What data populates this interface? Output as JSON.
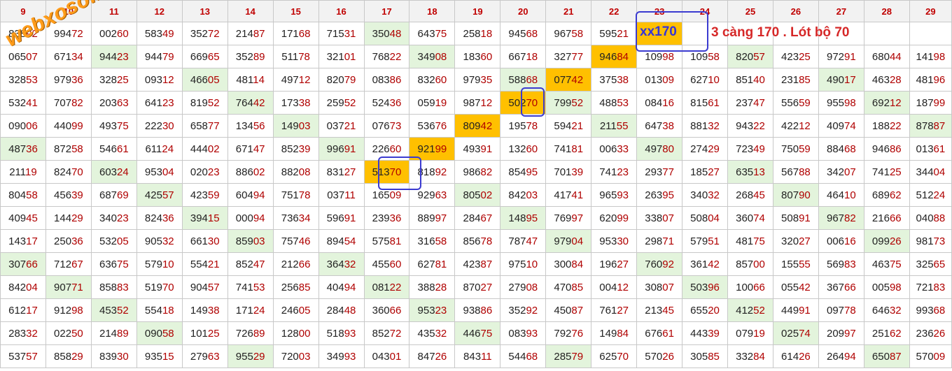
{
  "watermark": "webxoso.net",
  "annotation": {
    "xx": "xx170",
    "note": "3 càng 170 . Lót bộ 70"
  },
  "headers": [
    "9",
    "10",
    "11",
    "12",
    "13",
    "14",
    "15",
    "16",
    "17",
    "18",
    "19",
    "20",
    "21",
    "22",
    "23",
    "24",
    "25",
    "26",
    "27",
    "28",
    "29"
  ],
  "rows": [
    [
      "83892",
      "99472",
      "00260",
      "58349",
      "35272",
      "21487",
      "17168",
      "71531",
      "35048",
      "64375",
      "25818",
      "94568",
      "96758",
      "59521",
      "xx170",
      "",
      "",
      "",
      "",
      "",
      ""
    ],
    [
      "06507",
      "67134",
      "94423",
      "94479",
      "66965",
      "35289",
      "51178",
      "32101",
      "76822",
      "34908",
      "18360",
      "66718",
      "32777",
      "94684",
      "10998",
      "10958",
      "82057",
      "42325",
      "97291",
      "68044",
      "14198"
    ],
    [
      "32853",
      "97936",
      "32825",
      "09312",
      "46605",
      "48114",
      "49712",
      "82079",
      "08386",
      "83260",
      "97935",
      "58868",
      "07742",
      "37538",
      "01309",
      "62710",
      "85140",
      "23185",
      "49017",
      "46328",
      "48196"
    ],
    [
      "53241",
      "70782",
      "20363",
      "64123",
      "81952",
      "76442",
      "17338",
      "25952",
      "52436",
      "05919",
      "98712",
      "50270",
      "79952",
      "48853",
      "08416",
      "81561",
      "23747",
      "55659",
      "95598",
      "69212",
      "18799"
    ],
    [
      "09006",
      "44099",
      "49375",
      "22230",
      "65877",
      "13456",
      "14903",
      "03721",
      "07673",
      "53676",
      "80942",
      "19578",
      "59421",
      "21155",
      "64738",
      "88132",
      "94322",
      "42212",
      "40974",
      "18822",
      "87887"
    ],
    [
      "48736",
      "87258",
      "54661",
      "61124",
      "44402",
      "67147",
      "85239",
      "99691",
      "22660",
      "92199",
      "49391",
      "13260",
      "74181",
      "00633",
      "49780",
      "27429",
      "72349",
      "75059",
      "88468",
      "94686",
      "01361"
    ],
    [
      "21119",
      "82470",
      "60324",
      "95304",
      "02023",
      "88602",
      "88208",
      "83127",
      "51370",
      "81892",
      "98682",
      "85495",
      "70139",
      "74123",
      "29377",
      "18527",
      "63513",
      "56788",
      "34207",
      "74125",
      "34404"
    ],
    [
      "80458",
      "45639",
      "68769",
      "42557",
      "42359",
      "60494",
      "75178",
      "03711",
      "16509",
      "92963",
      "80502",
      "84203",
      "41741",
      "96593",
      "26395",
      "34032",
      "26845",
      "80790",
      "46410",
      "68962",
      "51224"
    ],
    [
      "40945",
      "14429",
      "34023",
      "82436",
      "39415",
      "00094",
      "73634",
      "59691",
      "23936",
      "88997",
      "28467",
      "14895",
      "76997",
      "62099",
      "33807",
      "50804",
      "36074",
      "50891",
      "96782",
      "21666",
      "04088"
    ],
    [
      "14317",
      "25036",
      "53205",
      "90532",
      "66130",
      "85903",
      "75746",
      "89454",
      "57581",
      "31658",
      "85678",
      "78747",
      "97904",
      "95330",
      "29871",
      "57951",
      "48175",
      "32027",
      "00616",
      "09926",
      "98173"
    ],
    [
      "30766",
      "71267",
      "63675",
      "57910",
      "55421",
      "85247",
      "21266",
      "36432",
      "45560",
      "62781",
      "42387",
      "97510",
      "30084",
      "19627",
      "76092",
      "36142",
      "85700",
      "15555",
      "56983",
      "46375",
      "32565"
    ],
    [
      "84204",
      "90771",
      "85883",
      "51970",
      "90457",
      "74153",
      "25685",
      "40494",
      "08122",
      "38828",
      "87027",
      "27908",
      "47085",
      "00412",
      "30807",
      "50396",
      "10066",
      "05542",
      "36766",
      "00598",
      "72183"
    ],
    [
      "61217",
      "91298",
      "45352",
      "55418",
      "14938",
      "17124",
      "24605",
      "28448",
      "36066",
      "95323",
      "93886",
      "35292",
      "45087",
      "76127",
      "21345",
      "65520",
      "41252",
      "44991",
      "09778",
      "64632",
      "99368"
    ],
    [
      "28332",
      "02250",
      "21489",
      "09058",
      "10125",
      "72689",
      "12800",
      "51893",
      "85272",
      "43532",
      "44675",
      "08393",
      "79276",
      "14984",
      "67661",
      "44339",
      "07919",
      "02574",
      "20997",
      "25162",
      "23626"
    ],
    [
      "53757",
      "85829",
      "83930",
      "93515",
      "27963",
      "95529",
      "72003",
      "34993",
      "04301",
      "84726",
      "84311",
      "54468",
      "28579",
      "62570",
      "57026",
      "30585",
      "33284",
      "61426",
      "26494",
      "65087",
      "57009"
    ]
  ],
  "green_cells": [
    [
      0,
      8
    ],
    [
      1,
      2
    ],
    [
      1,
      9
    ],
    [
      1,
      16
    ],
    [
      2,
      4
    ],
    [
      2,
      11
    ],
    [
      2,
      18
    ],
    [
      3,
      5
    ],
    [
      3,
      12
    ],
    [
      3,
      19
    ],
    [
      4,
      6
    ],
    [
      4,
      13
    ],
    [
      4,
      20
    ],
    [
      5,
      0
    ],
    [
      5,
      7
    ],
    [
      5,
      14
    ],
    [
      6,
      2
    ],
    [
      6,
      16
    ],
    [
      7,
      3
    ],
    [
      7,
      10
    ],
    [
      7,
      17
    ],
    [
      8,
      4
    ],
    [
      8,
      11
    ],
    [
      8,
      18
    ],
    [
      9,
      5
    ],
    [
      9,
      12
    ],
    [
      9,
      19
    ],
    [
      10,
      0
    ],
    [
      10,
      7
    ],
    [
      10,
      14
    ],
    [
      11,
      1
    ],
    [
      11,
      8
    ],
    [
      11,
      15
    ],
    [
      12,
      2
    ],
    [
      12,
      9
    ],
    [
      12,
      16
    ],
    [
      13,
      3
    ],
    [
      13,
      10
    ],
    [
      13,
      17
    ],
    [
      14,
      5
    ],
    [
      14,
      12
    ],
    [
      14,
      19
    ]
  ],
  "yellow_cells": [
    [
      1,
      13
    ],
    [
      2,
      12
    ],
    [
      3,
      11
    ],
    [
      4,
      10
    ],
    [
      5,
      9
    ],
    [
      6,
      8
    ],
    [
      0,
      14
    ]
  ]
}
